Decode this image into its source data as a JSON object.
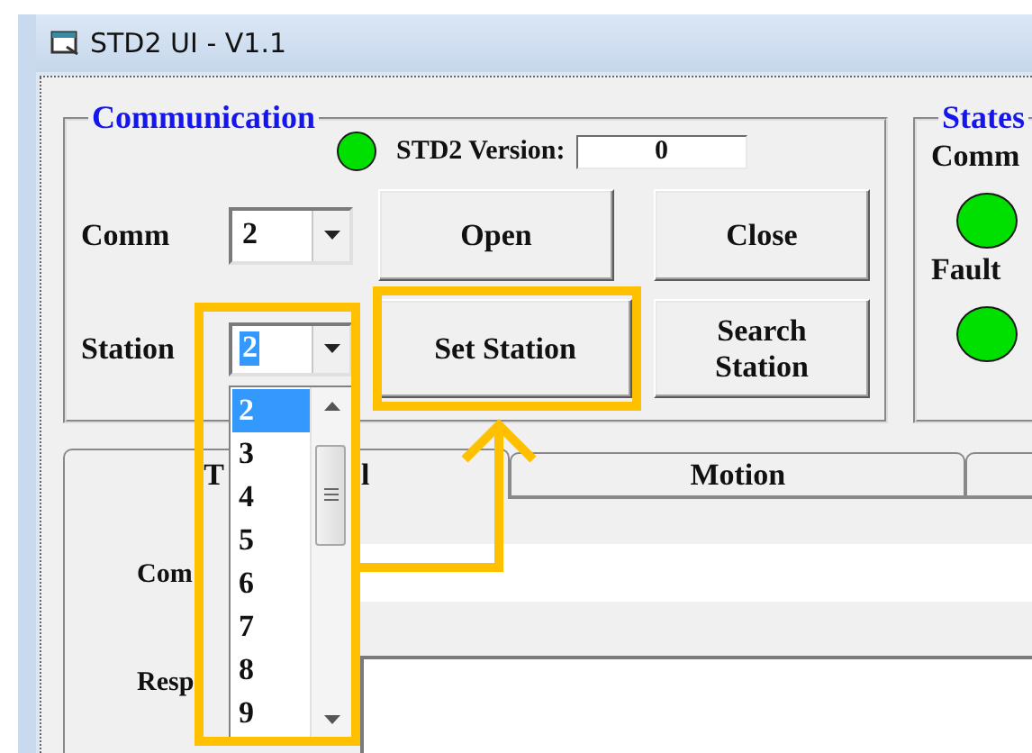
{
  "window": {
    "title": "STD2 UI - V1.1"
  },
  "communication": {
    "title": "Communication",
    "led": {
      "color": "#00e000"
    },
    "version_label": "STD2 Version:",
    "version_value": "0",
    "comm": {
      "label": "Comm",
      "value": "2"
    },
    "station": {
      "label": "Station",
      "value": "2",
      "focused": true,
      "expanded": true,
      "options": [
        {
          "label": "2",
          "selected": true
        },
        {
          "label": "3",
          "selected": false
        },
        {
          "label": "4",
          "selected": false
        },
        {
          "label": "5",
          "selected": false
        },
        {
          "label": "6",
          "selected": false
        },
        {
          "label": "7",
          "selected": false
        },
        {
          "label": "8",
          "selected": false
        },
        {
          "label": "9",
          "selected": false
        }
      ]
    },
    "buttons": [
      "Open",
      "Close",
      "Set Station",
      "Search Station"
    ]
  },
  "states": {
    "title": "States",
    "indicators": [
      {
        "label": "Comm",
        "color": "#00e000"
      },
      {
        "label": "Fault",
        "color": "#00e000"
      }
    ]
  },
  "tabs": [
    {
      "label_start": "T",
      "label_end": "l",
      "selected": true
    },
    {
      "label": "Motion",
      "selected": false
    },
    {
      "selected": false
    }
  ],
  "panel": {
    "command_label": "Com",
    "response_label": "Resp"
  }
}
